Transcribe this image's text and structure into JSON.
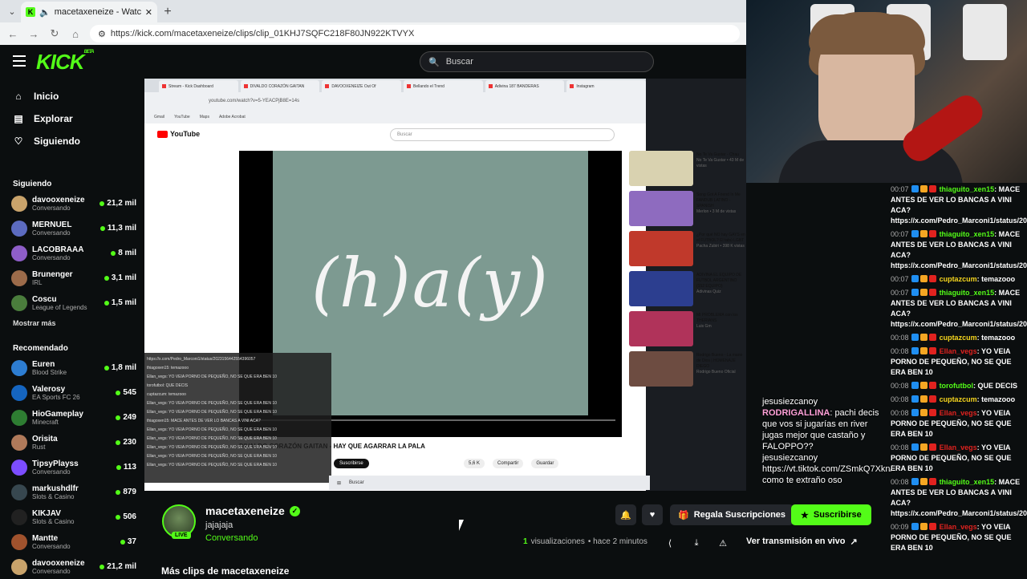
{
  "browser": {
    "tab_title": "macetaxeneize - Watch clips o",
    "url": "https://kick.com/macetaxeneize/clips/clip_01KHJ7SQFC218F80JN922KTVYX"
  },
  "header": {
    "logo": "KICK",
    "logo_badge": "BETA",
    "search_placeholder": "Buscar"
  },
  "nav": [
    {
      "label": "Inicio",
      "icon": "home-icon"
    },
    {
      "label": "Explorar",
      "icon": "compass-icon"
    },
    {
      "label": "Siguiendo",
      "icon": "heart-icon"
    }
  ],
  "following": {
    "title": "Siguiendo",
    "channels": [
      {
        "name": "davooxeneize",
        "category": "Conversando",
        "viewers": "21,2 mil",
        "color": "#c9a36b"
      },
      {
        "name": "MERNUEL",
        "category": "Conversando",
        "viewers": "11,3 mil",
        "color": "#5c6bc0"
      },
      {
        "name": "LACOBRAAA",
        "category": "Conversando",
        "viewers": "8 mil",
        "color": "#8e5ec8"
      },
      {
        "name": "Brunenger",
        "category": "IRL",
        "viewers": "3,1 mil",
        "color": "#9c6b4a"
      },
      {
        "name": "Coscu",
        "category": "League of Legends",
        "viewers": "1,5 mil",
        "color": "#4a7d3c"
      }
    ],
    "show_more": "Mostrar más"
  },
  "recommended": {
    "title": "Recomendado",
    "channels": [
      {
        "name": "Euren",
        "category": "Blood Strike",
        "viewers": "1,8 mil",
        "color": "#2d7dd2"
      },
      {
        "name": "Valerosy",
        "category": "EA Sports FC 26",
        "viewers": "545",
        "color": "#1565c0"
      },
      {
        "name": "HioGameplay",
        "category": "Minecraft",
        "viewers": "249",
        "color": "#2e7d32"
      },
      {
        "name": "Orisita",
        "category": "Rust",
        "viewers": "230",
        "color": "#b07a5a"
      },
      {
        "name": "TipsyPlayss",
        "category": "Conversando",
        "viewers": "113",
        "color": "#7c4dff"
      },
      {
        "name": "markushdlfr",
        "category": "Slots & Casino",
        "viewers": "879",
        "color": "#37474f"
      },
      {
        "name": "KIKJAV",
        "category": "Slots & Casino",
        "viewers": "506",
        "color": "#212121"
      },
      {
        "name": "Mantte",
        "category": "Conversando",
        "viewers": "37",
        "color": "#a0522d"
      },
      {
        "name": "davooxeneize",
        "category": "Conversando",
        "viewers": "21,2 mil",
        "color": "#c9a36b"
      }
    ]
  },
  "video": {
    "inner_tabs": [
      "Stream - Kick Dashboard",
      "DIVALDO CORAZÓN GAITAN",
      "DAVOOXENEIZE Out Of",
      "Bellando el Trend",
      "Adivina 187 BANDERAS",
      "Instagram"
    ],
    "inner_url": "youtube.com/watch?v=5-YEACPjB8E=14s",
    "bookmarks": [
      "Gmail",
      "YouTube",
      "Maps",
      "Adobe Acrobat"
    ],
    "yt_logo": "YouTube",
    "yt_search": "Buscar",
    "art_text": "(h)a(y)",
    "yt_title": "DIVALDO CORAZÓN GAITAN - HAY QUE AGARRAR LA PALA",
    "yt_subscribe": "Suscribirse",
    "yt_actions": [
      "5,6 K",
      "Compartir",
      "Guardar"
    ],
    "related": [
      {
        "title": "No Te Va Gustar - Chau",
        "meta": "No Te Va Gustar • 43 M de vistas",
        "color": "#d9d2b0"
      },
      {
        "title": "Song Got A Friend In Me FANDUB LATINO - SPANISH",
        "meta": "Merlon • 3 M de vistas",
        "color": "#8e6bbf"
      },
      {
        "title": "¿Por qué NO hay GAYS en el FUTBOL? El tabú LGBT",
        "meta": "Pacha Zubiri • 398 K vistas",
        "color": "#c0392b"
      },
      {
        "title": "ADIVINA EL EQUIPO DE FUTBOL ARGENTINO (152 EQUIPO)",
        "meta": "Adivinas Quiz",
        "color": "#2c3e8f"
      },
      {
        "title": "MI PROBLEMA con los THERIANS",
        "meta": "Luis Gm",
        "color": "#b0335a"
      },
      {
        "title": "Rodrigo Bueno - La mano de Dios | HOMENAJE DIEGO",
        "meta": "Rodrigo Bueno Oficial",
        "color": "#6d4c41"
      }
    ],
    "overlay_chat": [
      "https://x.com/Pedro_Marconi1/status/2023156442554396057",
      "thiagoxen15: temazooo",
      "Ellan_vegs: YO VEIA PORNO DE PEQUEÑO, NO SE QUE ERA BEN 10",
      "torofutbol: QUE DECIS",
      "cuptazcum: temazooo",
      "Ellan_vegs: YO VEIA PORNO DE PEQUEÑO, NO SE QUE ERA BEN 10",
      "Ellan_vegs: YO VEIA PORNO DE PEQUEÑO, NO SE QUE ERA BEN 10",
      "thiagoxen15: MACE ANTES DE VER LO BANCAS A VINI ACA?",
      "Ellan_vegs: YO VEIA PORNO DE PEQUEÑO, NO SE QUE ERA BEN 10",
      "Ellan_vegs: YO VEIA PORNO DE PEQUEÑO, NO SE QUE ERA BEN 10",
      "Ellan_vegs: YO VEIA PORNO DE PEQUEÑO, NO SE QUE ERA BEN 10",
      "Ellan_vegs: YO VEIA PORNO DE PEQUEÑO, NO SE QUE ERA BEN 10",
      "Ellan_vegs: YO VEIA PORNO DE PEQUEÑO, NO SE QUE ERA BEN 10"
    ],
    "taskbar_search": "Buscar",
    "overlay_right": {
      "user1": "jesusiezcanoy",
      "user2": "RODRIGALLINA",
      "msg2": ": pachi decis que vos si jugarías en river jugas mejor que castaño y FALOPPO??",
      "user3": "jesusiezcanoy",
      "msg3": "https://vt.tiktok.com/ZSmkQ7Xkn/ como te extraño oso"
    }
  },
  "chat": [
    {
      "time": "00:07",
      "user": "thiaguito_xen15",
      "color": "g",
      "text": "MACE ANTES DE VER LO BANCAS A VINI ACA? https://x.com/Pedro_Marconi1/status/2044255439057"
    },
    {
      "time": "00:07",
      "user": "thiaguito_xen15",
      "color": "g",
      "text": "MACE ANTES DE VER LO BANCAS A VINI ACA? https://x.com/Pedro_Marconi1/status/2044255439057"
    },
    {
      "time": "00:07",
      "user": "cuptazcum",
      "color": "y",
      "text": "temazooo"
    },
    {
      "time": "00:07",
      "user": "thiaguito_xen15",
      "color": "g",
      "text": "MACE ANTES DE VER LO BANCAS A VINI ACA? https://x.com/Pedro_Marconi1/status/2044255439057"
    },
    {
      "time": "00:08",
      "user": "cuptazcum",
      "color": "y",
      "text": "temazooo"
    },
    {
      "time": "00:08",
      "user": "Ellan_vegs",
      "color": "r",
      "text": "YO VEIA PORNO DE PEQUEÑO, NO SE QUE ERA BEN 10"
    },
    {
      "time": "00:08",
      "user": "torofutbol",
      "color": "g",
      "text": "QUE DECIS"
    },
    {
      "time": "00:08",
      "user": "cuptazcum",
      "color": "y",
      "text": "temazooo"
    },
    {
      "time": "00:08",
      "user": "Ellan_vegs",
      "color": "r",
      "text": "YO VEIA PORNO DE PEQUEÑO, NO SE QUE ERA BEN 10"
    },
    {
      "time": "00:08",
      "user": "Ellan_vegs",
      "color": "r",
      "text": "YO VEIA PORNO DE PEQUEÑO, NO SE QUE ERA BEN 10"
    },
    {
      "time": "00:08",
      "user": "thiaguito_xen15",
      "color": "g",
      "text": "MACE ANTES DE VER LO BANCAS A VINI ACA? https://x.com/Pedro_Marconi1/status/2044255439057"
    },
    {
      "time": "00:09",
      "user": "Ellan_vegs",
      "color": "r",
      "text": "YO VEIA PORNO DE PEQUEÑO, NO SE QUE ERA BEN 10"
    }
  ],
  "channel": {
    "name": "macetaxeneize",
    "live_label": "LIVE",
    "stream_title": "jajajaja",
    "category": "Conversando",
    "gift_label": "Regala Suscripciones",
    "subscribe_label": "Suscribirse",
    "views_count": "1",
    "views_label": "visualizaciones",
    "time_ago": "• hace 2 minutos",
    "watch_live": "Ver transmisión en vivo",
    "more_clips": "Más clips de macetaxeneize"
  }
}
